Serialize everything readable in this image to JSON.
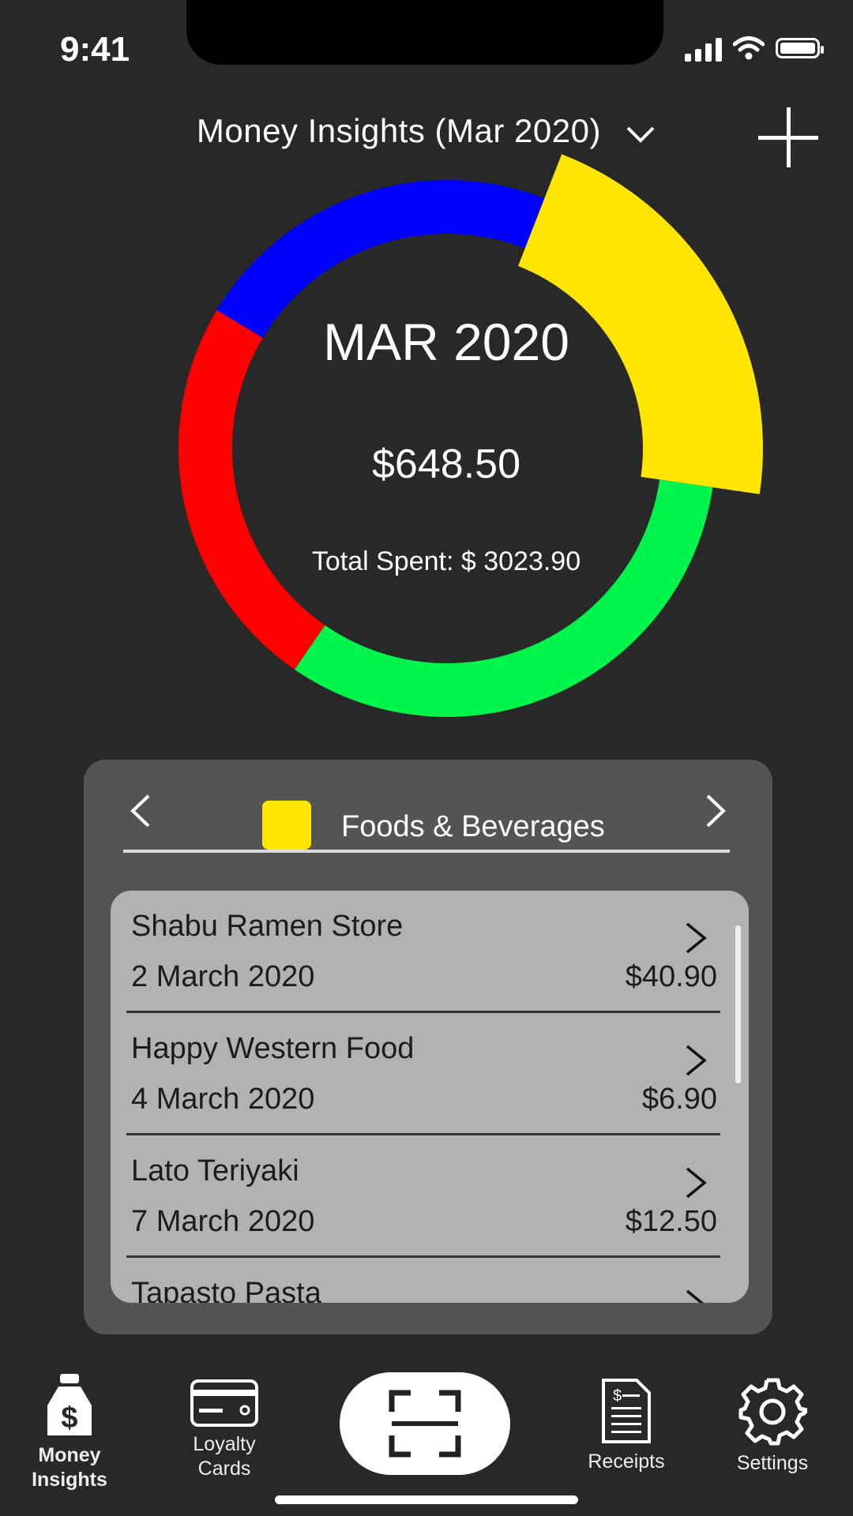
{
  "status_bar": {
    "time": "9:41"
  },
  "header": {
    "title": "Money Insights (Mar 2020)"
  },
  "summary": {
    "month": "MAR 2020",
    "category_amount": "$648.50",
    "total_spent": "Total Spent: $ 3023.90"
  },
  "chart_data": {
    "type": "pie",
    "style": "donut",
    "highlighted": "Foods & Beverages",
    "slices": [
      {
        "color": "#0000ff",
        "value": 0.223
      },
      {
        "color": "#ffe600",
        "value": 0.214,
        "highlighted": true
      },
      {
        "color": "#00f54c",
        "value": 0.323
      },
      {
        "color": "#ff0000",
        "value": 0.24
      }
    ]
  },
  "category": {
    "label": "Foods & Beverages",
    "color": "#ffe600"
  },
  "transactions": [
    {
      "name": "Shabu Ramen Store",
      "date": "2 March 2020",
      "amount": "$40.90"
    },
    {
      "name": "Happy Western Food",
      "date": "4 March 2020",
      "amount": "$6.90"
    },
    {
      "name": "Lato Teriyaki",
      "date": "7 March 2020",
      "amount": "$12.50"
    },
    {
      "name": "Tapasto Pasta",
      "date": "",
      "amount": ""
    }
  ],
  "tabs": {
    "money_line1": "Money",
    "money_line2": "Insights",
    "loyalty_line1": "Loyalty",
    "loyalty_line2": "Cards",
    "receipts": "Receipts",
    "settings": "Settings"
  },
  "icons": {
    "dropdown": "chevron-down-icon",
    "add": "plus-icon",
    "prev": "chevron-left-icon",
    "next": "chevron-right-icon",
    "money": "money-bag-icon",
    "loyalty": "card-icon",
    "scan": "scan-icon",
    "receipts": "receipt-icon",
    "settings": "gear-icon"
  }
}
